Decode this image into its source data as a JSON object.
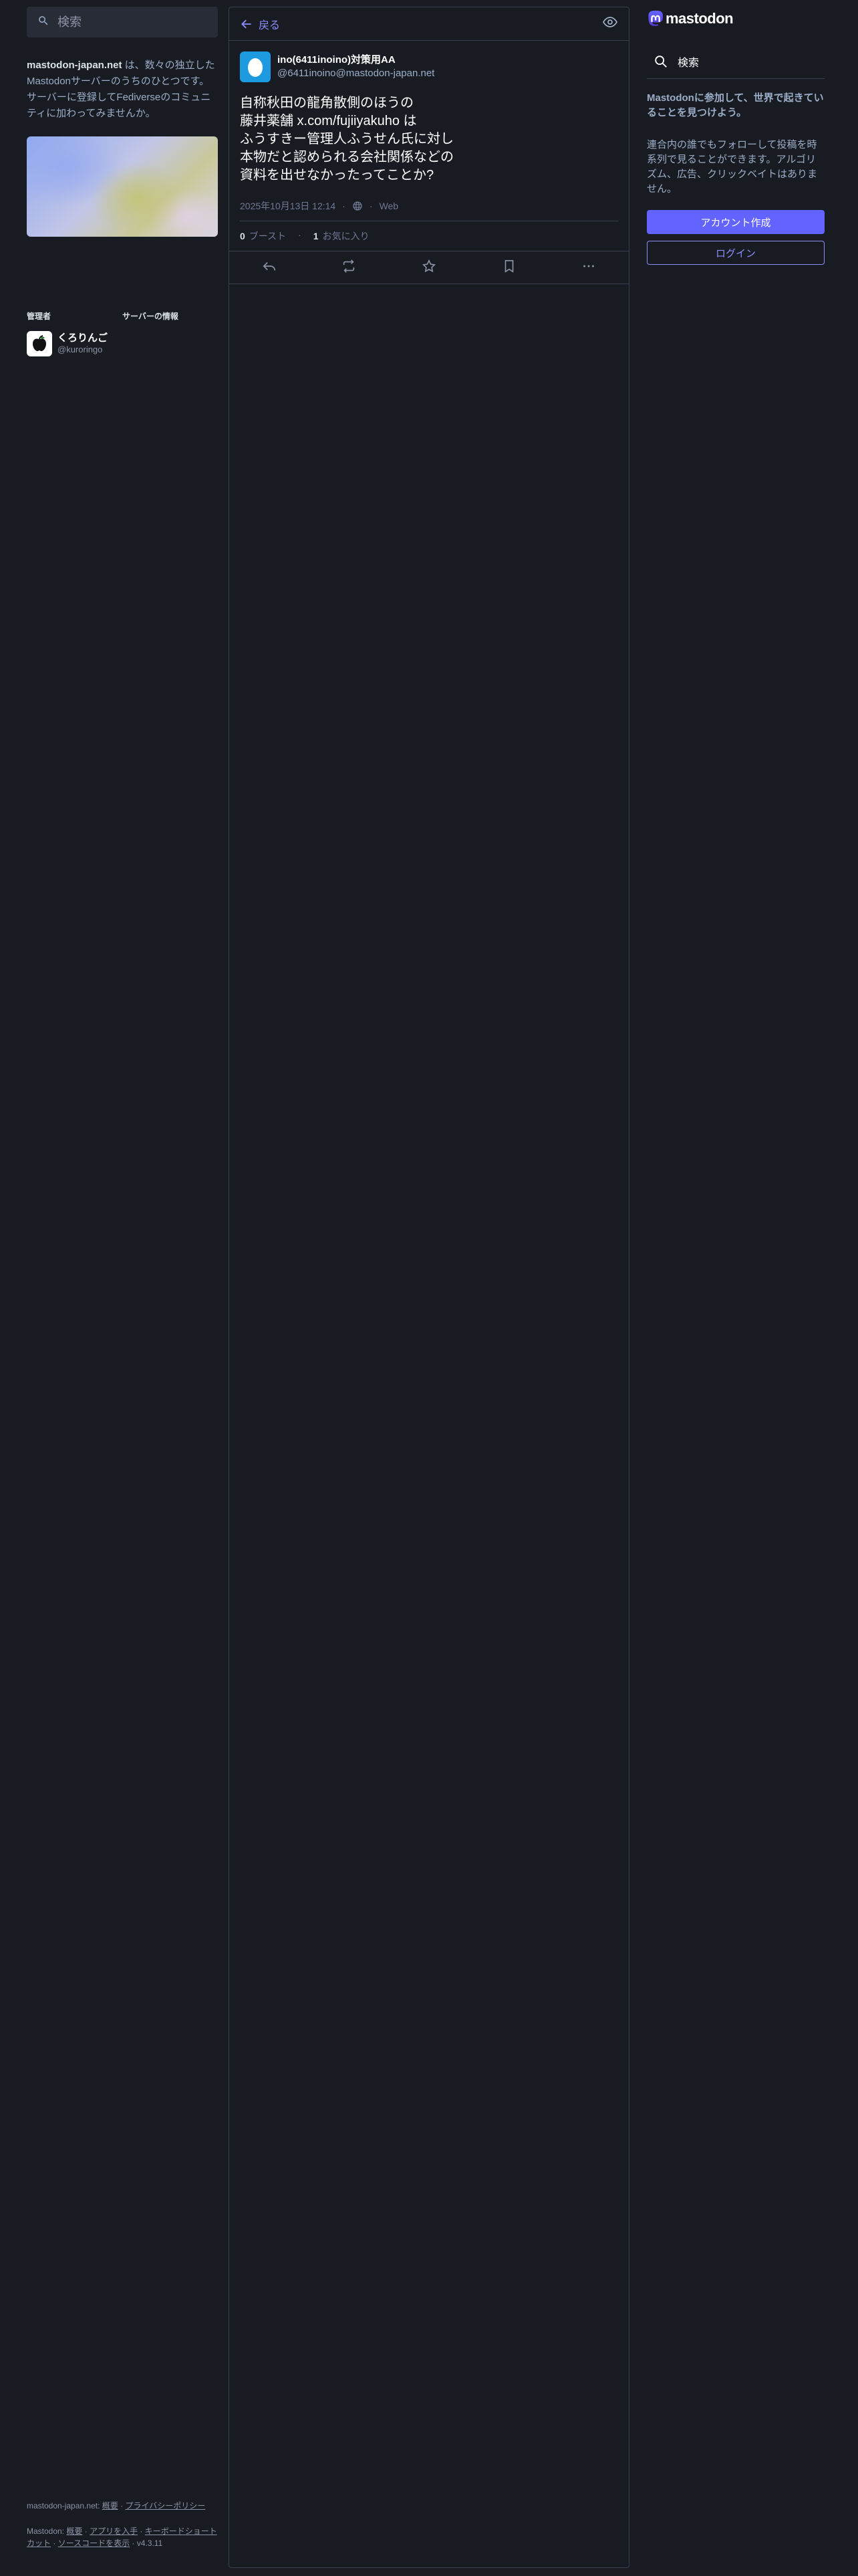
{
  "search": {
    "placeholder": "検索"
  },
  "about": {
    "server_name": "mastodon-japan.net",
    "description": " は、数々の独立したMastodonサーバーのうちのひとつです。サーバーに登録してFediverseのコミュニティに加わってみませんか。"
  },
  "admin": {
    "section_label": "管理者",
    "name": "くろりんご",
    "handle": "@kuroringo"
  },
  "server_info": {
    "section_label": "サーバーの情報"
  },
  "header": {
    "back_label": "戻る"
  },
  "status": {
    "display_name": "ino(6411inoino)対策用AA",
    "acct": "@6411inoino@mastodon-japan.net",
    "content": "自称秋田の龍角散側のほうの\n藤井薬舗 x.com/fujiiyakuho は\nふうすきー管理人ふうせん氏に対し\n本物だと認められる会社関係などの\n資料を出せなかったってことか?",
    "timestamp": "2025年10月13日 12:14",
    "application": "Web",
    "boosts_count": "0",
    "boosts_label": "ブースト",
    "favourites_count": "1",
    "favourites_label": "お気に入り"
  },
  "footer": {
    "server_line_prefix": "mastodon-japan.net: ",
    "about_link": "概要",
    "privacy_link": "プライバシーポリシー",
    "mastodon_prefix": "Mastodon: ",
    "mastodon_about_link": "概要",
    "get_app_link": "アプリを入手",
    "shortcuts_link": "キーボードショートカット",
    "source_link": "ソースコードを表示",
    "version": "v4.3.11",
    "separator": " · "
  },
  "right": {
    "logo_text": "mastodon",
    "nav_search": "検索",
    "signup_lead": "Mastodonに参加して、世界で起きていることを見つけよう。",
    "signup_body": "連合内の誰でもフォローして投稿を時系列で見ることができます。アルゴリズム、広告、クリックベイトはありません。",
    "create_account": "アカウント作成",
    "login": "ログイン"
  },
  "colors": {
    "background": "#191b22",
    "accent": "#6364ff",
    "link": "#8c8dff"
  },
  "icons": [
    "search-icon",
    "back-arrow-icon",
    "eye-icon",
    "globe-icon",
    "reply-icon",
    "boost-icon",
    "star-icon",
    "bookmark-icon",
    "more-icon"
  ]
}
